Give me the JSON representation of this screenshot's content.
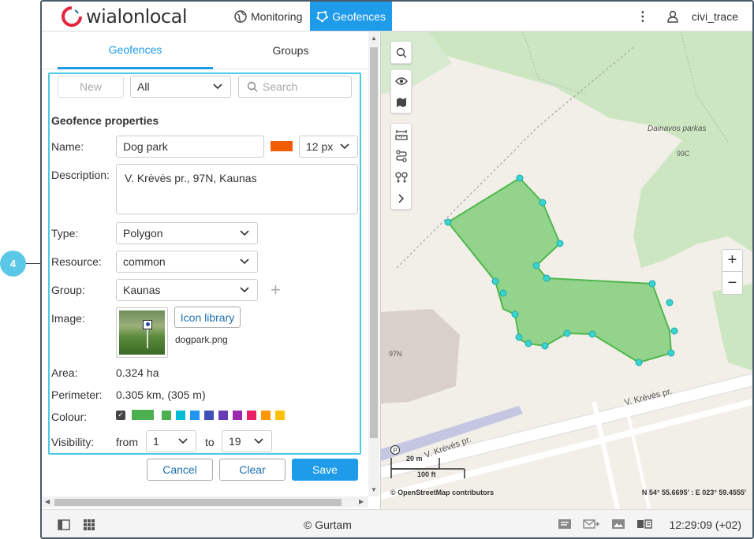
{
  "header": {
    "logo_brand": "wialon",
    "logo_suffix": "local",
    "nav": {
      "monitoring": "Monitoring",
      "geofences": "Geofences"
    },
    "username": "civi_trace"
  },
  "panel": {
    "tabs": {
      "geofences": "Geofences",
      "groups": "Groups"
    },
    "toolbar": {
      "new_label": "New",
      "filter_value": "All",
      "search_placeholder": "Search"
    },
    "section_title": "Geofence properties",
    "fields": {
      "name_label": "Name:",
      "name_value": "Dog park",
      "name_color": "#f25c05",
      "line_width": "12 px",
      "description_label": "Description:",
      "description_value": "V. Krėvės pr., 97N, Kaunas",
      "type_label": "Type:",
      "type_value": "Polygon",
      "resource_label": "Resource:",
      "resource_value": "common",
      "group_label": "Group:",
      "group_value": "Kaunas",
      "image_label": "Image:",
      "icon_library_label": "Icon library",
      "image_filename": "dogpark.png",
      "area_label": "Area:",
      "area_value": "0.324 ha",
      "perimeter_label": "Perimeter:",
      "perimeter_value": "0.305 km, (305 m)",
      "colour_label": "Colour:",
      "colour_selected": "#4caf50",
      "colour_options": [
        "#4caf50",
        "#00bcd4",
        "#2196f3",
        "#3f51b5",
        "#673ab7",
        "#9c27b0",
        "#e91e63",
        "#ff9800",
        "#ffc107"
      ],
      "visibility_label": "Visibility:",
      "visibility_from_label": "from",
      "visibility_from_value": "1",
      "visibility_to_label": "to",
      "visibility_to_value": "19"
    },
    "actions": {
      "cancel": "Cancel",
      "clear": "Clear",
      "save": "Save"
    }
  },
  "map": {
    "labels": {
      "park": "Dainavos parkas",
      "house_99c": "99C",
      "house_97n": "97N",
      "street_1": "V. Krėvės pr.",
      "street_2": "V. Krėvės pr."
    },
    "scale_metric": "20 m",
    "scale_imperial": "100 ft",
    "attribution": "© OpenStreetMap contributors",
    "coordinates": "N 54° 55.6695' : E 023° 59.4555'",
    "polygon_color": "#5fc35a"
  },
  "footer": {
    "copyright": "© Gurtam",
    "time": "12:29:09 (+02)"
  },
  "callout": {
    "number": "4"
  }
}
